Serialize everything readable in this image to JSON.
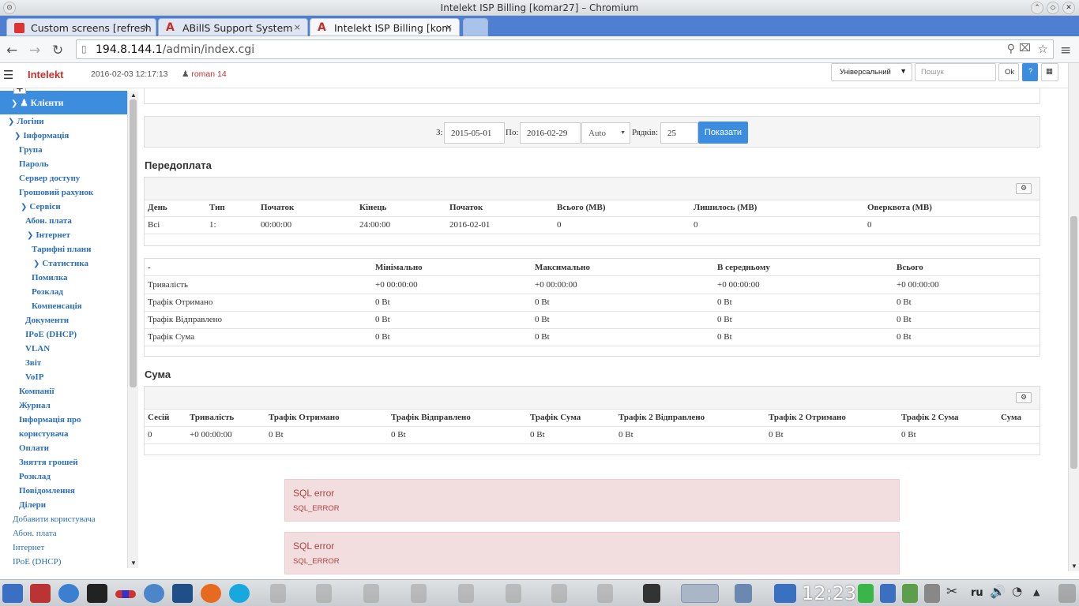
{
  "window": {
    "title": "Intelekt ISP Billing [komar27] – Chromium"
  },
  "tabs": [
    {
      "label": "Custom screens [refresh",
      "close": "×"
    },
    {
      "label": "ABillS Support System",
      "close": "×"
    },
    {
      "label": "Intelekt ISP Billing [kom",
      "close": "×"
    }
  ],
  "address": {
    "host": "194.8.144.1",
    "path": "/admin/index.cgi"
  },
  "header": {
    "brand": "Intelekt",
    "datetime": "2016-02-03 12:17:13",
    "user": "roman 14",
    "select_value": "Універсальний",
    "search_placeholder": "Пошук",
    "ok_label": "Ok",
    "help_label": "?"
  },
  "sidebar": {
    "plus": "+",
    "selected": "Клієнти",
    "items": [
      {
        "label": "Логіни",
        "chev": true
      },
      {
        "label": "Інформація",
        "chev": true
      },
      {
        "label": "Група"
      },
      {
        "label": "Пароль"
      },
      {
        "label": "Сервер доступу"
      },
      {
        "label": "Грошовий рахунок"
      },
      {
        "label": "Сервіси",
        "chev": true
      },
      {
        "label": "Абон. плата"
      },
      {
        "label": "Інтернет",
        "chev": true
      },
      {
        "label": "Тарифні плани"
      },
      {
        "label": "Статистика",
        "chev": true
      },
      {
        "label": "Помилка"
      },
      {
        "label": "Розклад"
      },
      {
        "label": "Компенсація"
      },
      {
        "label": "Документи"
      },
      {
        "label": "IPoE (DHCP)"
      },
      {
        "label": "VLAN"
      },
      {
        "label": "Звіт"
      },
      {
        "label": "VoIP"
      },
      {
        "label": "Компанії"
      },
      {
        "label": "Журнал"
      },
      {
        "label": "Інформація про"
      },
      {
        "label": "користувача"
      },
      {
        "label": "Оплати"
      },
      {
        "label": "Зняття грошей"
      },
      {
        "label": "Розклад"
      },
      {
        "label": "Повідомлення"
      },
      {
        "label": "Ділери"
      },
      {
        "label": "Добавити користувача"
      },
      {
        "label": "Абон. плата"
      },
      {
        "label": "Інтернет"
      },
      {
        "label": "IPoE (DHCP)"
      }
    ]
  },
  "filter": {
    "from_label": "З:",
    "from_value": "2015-05-01",
    "to_label": "По:",
    "to_value": "2016-02-29",
    "mode_value": "Auto",
    "rows_label": "Рядків:",
    "rows_value": "25",
    "show_button": "Показати"
  },
  "prepaid": {
    "title": "Передоплата",
    "headers": [
      "День",
      "Тип",
      "Початок",
      "Кінець",
      "Початок",
      "Всього (MB)",
      "Лишилось (MB)",
      "Оверквота (MB)"
    ],
    "rows": [
      [
        "Всі",
        "1:",
        "00:00:00",
        "24:00:00",
        "2016-02-01",
        "0",
        "0",
        "0"
      ]
    ]
  },
  "stats": {
    "headers": [
      "-",
      "Мінімально",
      "Максимально",
      "В середньому",
      "Всього"
    ],
    "rows": [
      [
        "Тривалість",
        "+0 00:00:00",
        "+0 00:00:00",
        "+0 00:00:00",
        "+0 00:00:00"
      ],
      [
        "Трафік Отримано",
        "0 Bt",
        "0 Bt",
        "0 Bt",
        "0 Bt"
      ],
      [
        "Трафік Відправлено",
        "0 Bt",
        "0 Bt",
        "0 Bt",
        "0 Bt"
      ],
      [
        "Трафік Сума",
        "0 Bt",
        "0 Bt",
        "0 Bt",
        "0 Bt"
      ]
    ]
  },
  "sum": {
    "title": "Сума",
    "headers": [
      "Сесій",
      "Тривалість",
      "Трафік Отримано",
      "Трафік Відправлено",
      "Трафік Сума",
      "Трафік 2 Відправлено",
      "Трафік 2 Отримано",
      "Трафік 2 Сума",
      "Сума"
    ],
    "rows": [
      [
        "0",
        "+0 00:00:00",
        "0 Bt",
        "0 Bt",
        "0 Bt",
        "0 Bt",
        "0 Bt",
        "0 Bt",
        ""
      ]
    ]
  },
  "errors": [
    {
      "title": "SQL error",
      "code": "SQL_ERROR"
    },
    {
      "title": "SQL error",
      "code": "SQL_ERROR"
    }
  ],
  "taskbar": {
    "clock": "12:23",
    "lang": "ru"
  },
  "colors": {
    "accent": "#3c8dde",
    "brand": "#c9302c",
    "error_bg": "#f2dede"
  }
}
